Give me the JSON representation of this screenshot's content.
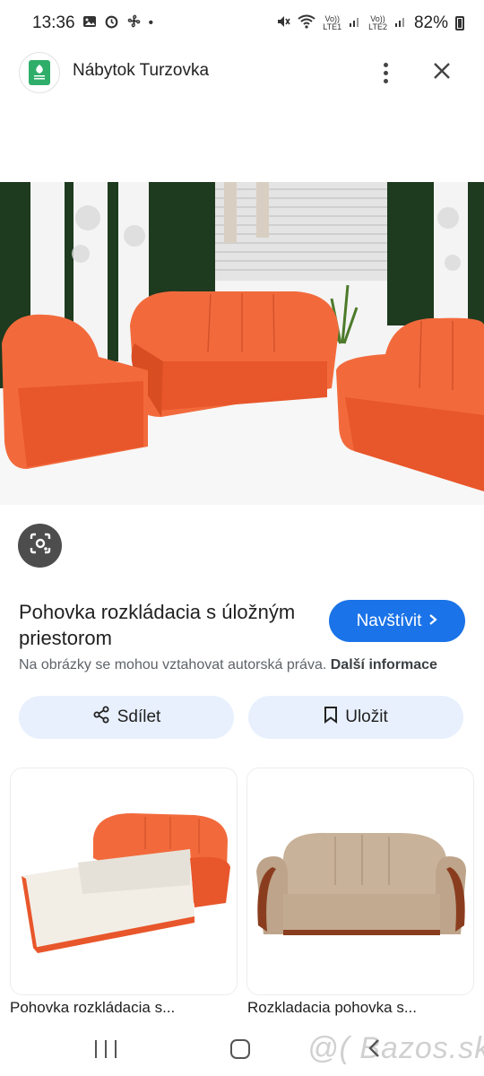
{
  "status_bar": {
    "time": "13:36",
    "left_icons": [
      "image-icon",
      "alarm-icon",
      "fan-icon"
    ],
    "lte1": "LTE1",
    "lte2": "LTE2",
    "vo1": "Vo))",
    "vo2": "Vo))",
    "battery": "82%"
  },
  "header": {
    "site_name": "Nábytok Turzovka",
    "logo_text": "NÁBYTOK TURZOVKA"
  },
  "result": {
    "title": "Pohovka rozkládacia s úložným priestorom",
    "visit_label": "Navštívit",
    "copyright_text": "Na obrázky se mohou vztahovat autorská práva.",
    "more_info": "Další informace",
    "share_label": "Sdílet",
    "save_label": "Uložit"
  },
  "related": [
    {
      "label": "Pohovka rozkládacia s..."
    },
    {
      "label": "Rozkladacia pohovka s..."
    }
  ],
  "watermark": "@( Bazos.sk",
  "colors": {
    "accent": "#1a73e8",
    "chip_bg": "#e8f0fe",
    "sofa_orange": "#f26a3c",
    "sofa_beige": "#c9b29a"
  }
}
